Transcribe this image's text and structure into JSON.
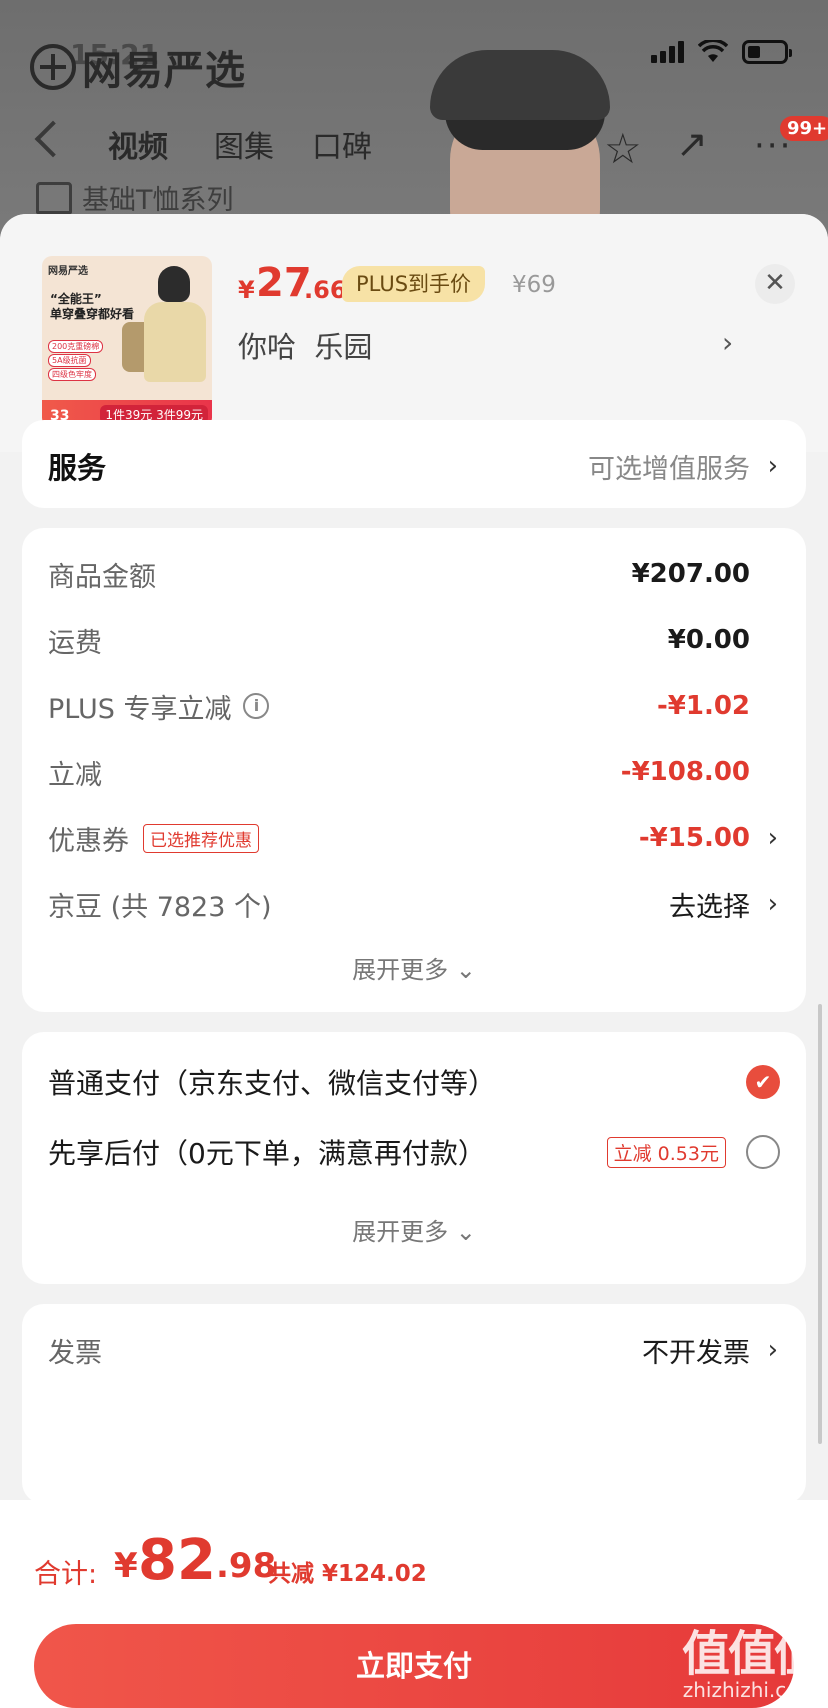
{
  "status_bar": {
    "time": "15:21"
  },
  "page_behind": {
    "brand": "网易严选",
    "tabs": [
      "视频",
      "图集",
      "口碑"
    ],
    "series": "基础T恤系列",
    "more_badge": "99+"
  },
  "product": {
    "thumb": {
      "brand": "网易严选",
      "title": "“全能王”\n单穿叠穿都好看",
      "tags": [
        "200克重磅棉",
        "5A级抗菌",
        "四级色牢度"
      ],
      "price": "33",
      "deal": "1件39元 3件99元"
    },
    "price_yen": "¥",
    "price_int": "27",
    "price_dec": ".66",
    "plus_label": "PLUS到手价",
    "original_price": "¥69",
    "variant": "你哈  乐园"
  },
  "service": {
    "label": "服务",
    "value": "可选增值服务"
  },
  "summary": {
    "goods_label": "商品金额",
    "goods_value": "¥207.00",
    "shipping_label": "运费",
    "shipping_value": "¥0.00",
    "plus_label": "PLUS 专享立减",
    "plus_value": "-¥1.02",
    "discount_label": "立减",
    "discount_value": "-¥108.00",
    "coupon_label": "优惠券",
    "coupon_tag": "已选推荐优惠",
    "coupon_value": "-¥15.00",
    "beans_label": "京豆 (共 7823 个)",
    "beans_value": "去选择",
    "expand": "展开更多"
  },
  "payment": {
    "normal": "普通支付（京东支付、微信支付等）",
    "later": "先享后付（0元下单，满意再付款）",
    "later_tag": "立减 0.53元",
    "expand": "展开更多"
  },
  "invoice": {
    "label": "发票",
    "value": "不开发票"
  },
  "footer": {
    "total_label": "合计:",
    "total_yen": "¥",
    "total_int": "82",
    "total_dec": ".98",
    "total_save": "共减 ¥124.02",
    "pay_button": "立即支付"
  },
  "watermark": {
    "logo": "值值值",
    "url": "zhizhizhi.com"
  },
  "colors": {
    "accent": "#e03a2f",
    "button": "#ea4440",
    "plus_tag": "#f7e2a6"
  }
}
